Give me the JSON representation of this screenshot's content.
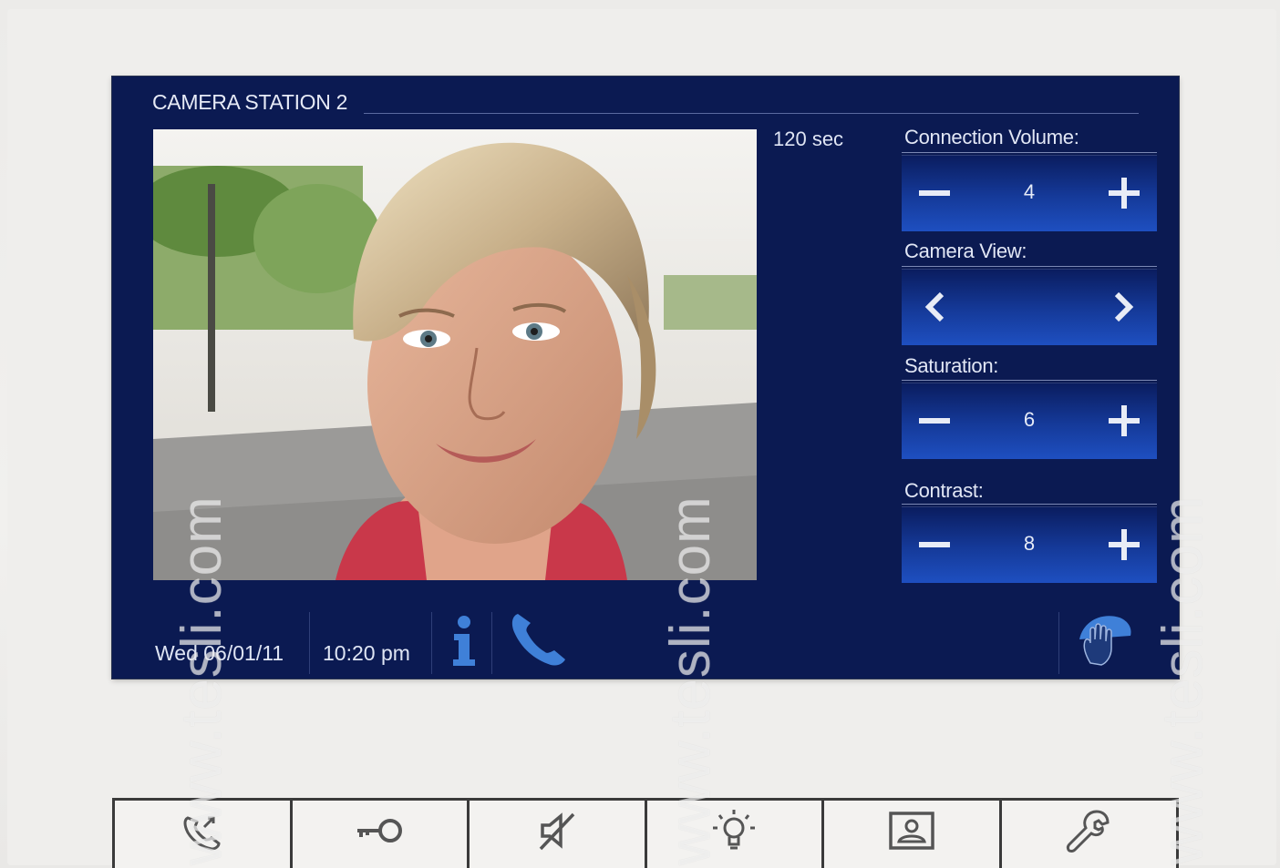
{
  "screen": {
    "title": "CAMERA STATION 2",
    "timer": "120 sec",
    "controls": [
      {
        "label": "Connection Volume:",
        "value": "4",
        "type": "stepper"
      },
      {
        "label": "Camera View:",
        "value": "",
        "type": "arrows"
      },
      {
        "label": "Saturation:",
        "value": "6",
        "type": "stepper"
      },
      {
        "label": "Contrast:",
        "value": "8",
        "type": "stepper"
      }
    ],
    "status": {
      "date": "Wed 06/01/11",
      "time": "10:20 pm",
      "icons": [
        "info-icon",
        "phone-handset-icon",
        "hand-wipe-icon"
      ]
    }
  },
  "hardware_buttons": [
    "call-accept-icon",
    "door-key-icon",
    "mute-icon",
    "light-bulb-icon",
    "camera-station-icon",
    "wrench-settings-icon"
  ],
  "watermark": "www.tesli.com",
  "colors": {
    "screen_bg": "#0b1a52",
    "button_gradient_bottom": "#1e4fc0",
    "accent_icon": "#3f80d8"
  }
}
